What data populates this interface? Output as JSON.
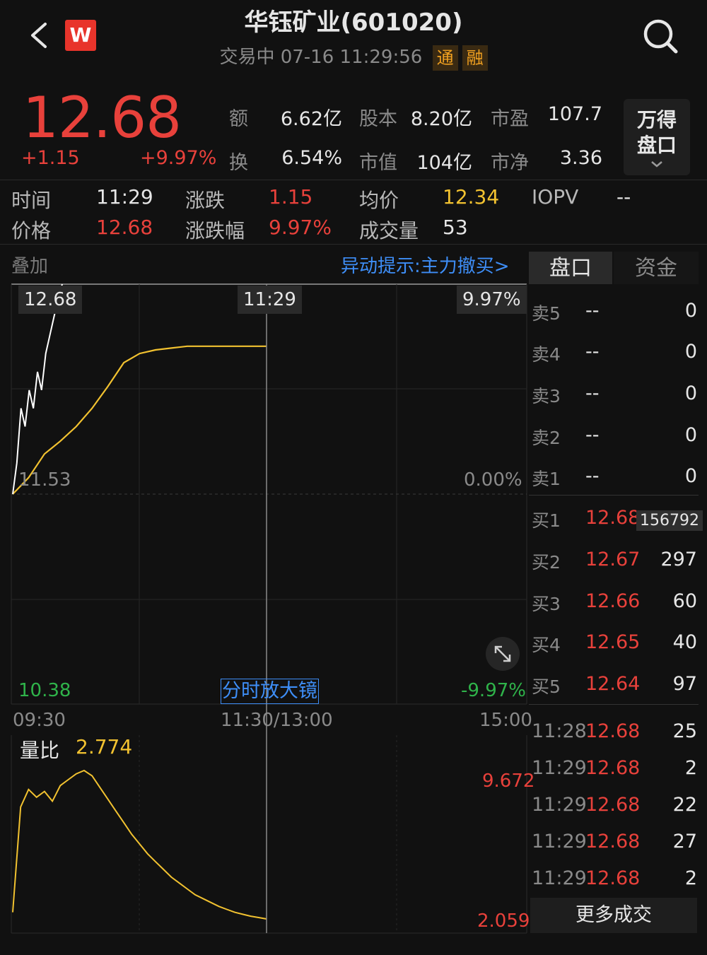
{
  "header": {
    "title": "华钰矿业(601020)",
    "status": "交易中 07-16 11:29:56",
    "tags": [
      "通",
      "融"
    ],
    "logo_letter": "W"
  },
  "quote": {
    "price": "12.68",
    "change": "+1.15",
    "change_pct": "+9.97%",
    "stats": [
      {
        "label": "额",
        "value": "6.62亿"
      },
      {
        "label": "股本",
        "value": "8.20亿"
      },
      {
        "label": "市盈",
        "value": "107.7"
      },
      {
        "label": "换",
        "value": "6.54%"
      },
      {
        "label": "市值",
        "value": "104亿"
      },
      {
        "label": "市净",
        "value": "3.36"
      }
    ],
    "wande_label": "万得\n盘口"
  },
  "info": {
    "time_label": "时间",
    "time_value": "11:29",
    "chg_label": "涨跌",
    "chg_value": "1.15",
    "avg_label": "均价",
    "avg_value": "12.34",
    "iopv_label": "IOPV",
    "iopv_value": "--",
    "price_label": "价格",
    "price_value": "12.68",
    "chgpct_label": "涨跌幅",
    "chgpct_value": "9.97%",
    "vol_label": "成交量",
    "vol_value": "53"
  },
  "chart": {
    "overlay_label": "叠加",
    "alert_text": "异动提示:主力撤买>",
    "badge_high": "12.68",
    "badge_time": "11:29",
    "badge_pct": "9.97%",
    "mid_price": "11.53",
    "mid_pct": "0.00%",
    "low_price": "10.38",
    "low_pct": "-9.97%",
    "magnifier": "分时放大镜",
    "time_start": "09:30",
    "time_mid": "11:30/13:00",
    "time_end": "15:00",
    "vr_label": "量比",
    "vr_value": "2.774",
    "vr_max": "9.672",
    "vr_min": "2.059"
  },
  "chart_data": {
    "type": "line",
    "title": "",
    "xlabel": "",
    "ylabel": "",
    "ylim": [
      10.38,
      12.68
    ],
    "x_ticks": [
      "09:30",
      "11:30/13:00",
      "15:00"
    ],
    "series": [
      {
        "values": [
          11.53,
          11.7,
          12.0,
          11.9,
          12.1,
          12.0,
          12.2,
          12.1,
          12.3,
          12.4,
          12.5,
          12.6,
          12.68
        ]
      },
      {
        "values": [
          11.53,
          11.62,
          11.75,
          11.82,
          11.9,
          12.0,
          12.12,
          12.25,
          12.3,
          12.32,
          12.33,
          12.34,
          12.34,
          12.34,
          12.34,
          12.34,
          12.34
        ]
      }
    ],
    "volume_ratio": {
      "ylim": [
        2.059,
        9.672
      ],
      "values": [
        2.4,
        7.8,
        8.7,
        8.3,
        8.6,
        8.1,
        8.9,
        9.2,
        9.5,
        9.672,
        9.4,
        8.8,
        8.2,
        7.6,
        7.0,
        6.4,
        5.9,
        5.4,
        5.0,
        4.6,
        4.2,
        3.9,
        3.6,
        3.3,
        3.1,
        2.9,
        2.7,
        2.55,
        2.4,
        2.3,
        2.2,
        2.13,
        2.06
      ]
    }
  },
  "orderbook": {
    "tab_active": "盘口",
    "tab_other": "资金",
    "asks": [
      {
        "label": "卖5",
        "price": "--",
        "vol": "0"
      },
      {
        "label": "卖4",
        "price": "--",
        "vol": "0"
      },
      {
        "label": "卖3",
        "price": "--",
        "vol": "0"
      },
      {
        "label": "卖2",
        "price": "--",
        "vol": "0"
      },
      {
        "label": "卖1",
        "price": "--",
        "vol": "0"
      }
    ],
    "bids": [
      {
        "label": "买1",
        "price": "12.68",
        "vol": "156792"
      },
      {
        "label": "买2",
        "price": "12.67",
        "vol": "297"
      },
      {
        "label": "买3",
        "price": "12.66",
        "vol": "60"
      },
      {
        "label": "买4",
        "price": "12.65",
        "vol": "40"
      },
      {
        "label": "买5",
        "price": "12.64",
        "vol": "97"
      }
    ],
    "trades": [
      {
        "time": "11:28",
        "price": "12.68",
        "vol": "25"
      },
      {
        "time": "11:29",
        "price": "12.68",
        "vol": "2"
      },
      {
        "time": "11:29",
        "price": "12.68",
        "vol": "22"
      },
      {
        "time": "11:29",
        "price": "12.68",
        "vol": "27"
      },
      {
        "time": "11:29",
        "price": "12.68",
        "vol": "2"
      }
    ],
    "more_trades": "更多成交"
  },
  "colors": {
    "up": "#e8413b",
    "down": "#2fb34a",
    "avg": "#f2c230",
    "price_line": "#ffffff"
  }
}
